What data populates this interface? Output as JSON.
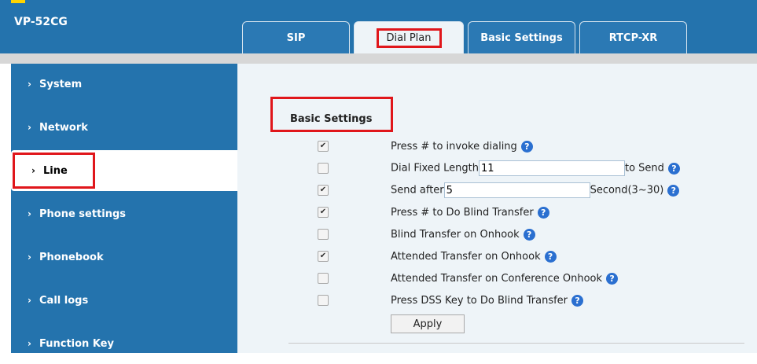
{
  "header": {
    "brand": "VP-52CG"
  },
  "tabs": [
    {
      "label": "SIP"
    },
    {
      "label": "Dial Plan",
      "active": true
    },
    {
      "label": "Basic Settings"
    },
    {
      "label": "RTCP-XR"
    }
  ],
  "sidebar": {
    "items": [
      {
        "label": "System"
      },
      {
        "label": "Network"
      },
      {
        "label": "Line",
        "active": true
      },
      {
        "label": "Phone settings"
      },
      {
        "label": "Phonebook"
      },
      {
        "label": "Call logs"
      },
      {
        "label": "Function Key"
      }
    ]
  },
  "section": {
    "title": "Basic Settings"
  },
  "settings": [
    {
      "checked": true,
      "label": "Press # to invoke dialing"
    },
    {
      "checked": false,
      "label": "Dial Fixed Length",
      "value": "11",
      "suffix": "to Send"
    },
    {
      "checked": true,
      "label": "Send after",
      "value": "5",
      "suffix": "Second(3~30)"
    },
    {
      "checked": true,
      "label": "Press # to Do Blind Transfer"
    },
    {
      "checked": false,
      "label": "Blind Transfer on Onhook"
    },
    {
      "checked": true,
      "label": "Attended Transfer on Onhook"
    },
    {
      "checked": false,
      "label": "Attended Transfer on Conference Onhook"
    },
    {
      "checked": false,
      "label": "Press DSS Key to Do Blind Transfer"
    }
  ],
  "apply_label": "Apply",
  "icons": {
    "help": "question-circle-icon",
    "check": "✔",
    "chevron": "›"
  },
  "colors": {
    "header_bg": "#2473ad",
    "highlight": "#e0161b",
    "help_icon": "#2a6fd0",
    "content_bg": "#eef4f8"
  }
}
